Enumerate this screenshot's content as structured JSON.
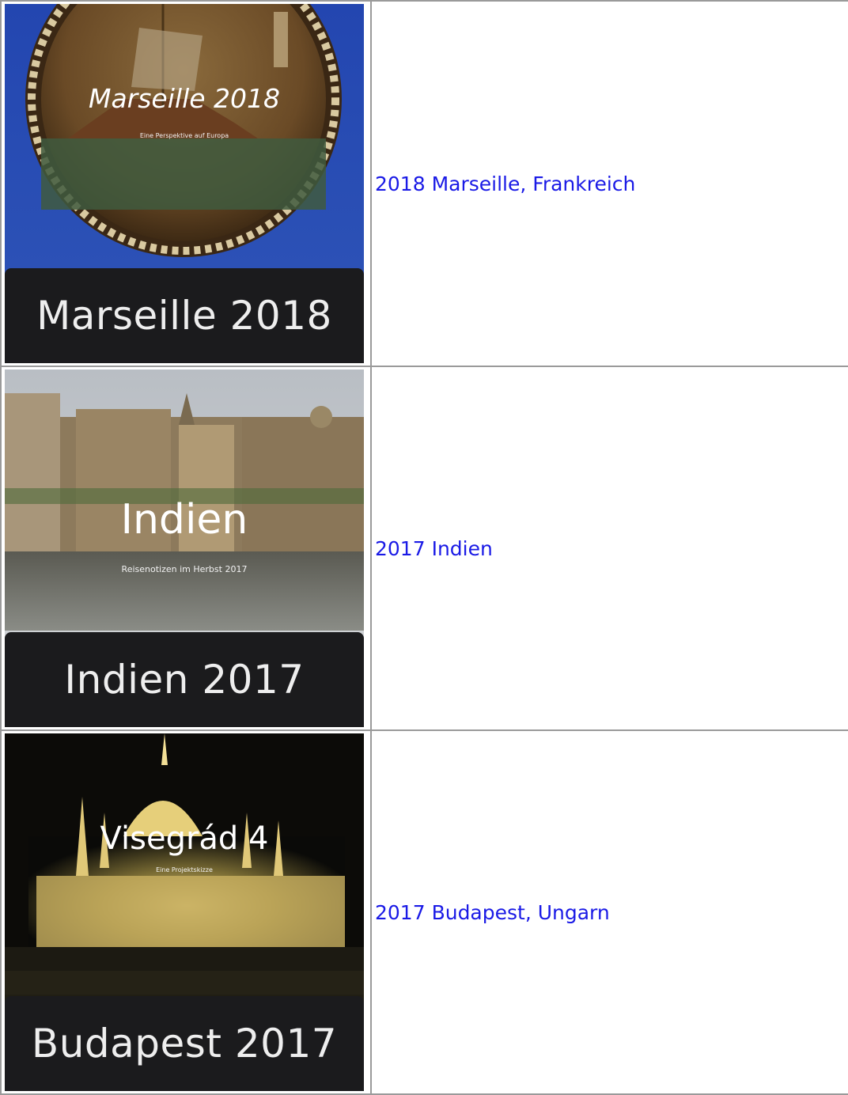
{
  "rows": [
    {
      "cover_title": "Marseille 2018",
      "cover_subtitle": "Eine Perspektive auf Europa",
      "caption": "Marseille 2018",
      "link": "2018 Marseille, Frankreich"
    },
    {
      "cover_title": "Indien",
      "cover_subtitle": "Reisenotizen im Herbst 2017",
      "caption": "Indien 2017",
      "link": "2017 Indien"
    },
    {
      "cover_title": "Visegrád 4",
      "cover_subtitle": "Eine Projektskizze",
      "caption": "Budapest 2017",
      "link": "2017 Budapest, Ungarn"
    }
  ],
  "colors": {
    "link": "#1a1ae6",
    "border": "#9a9a9a",
    "caption_bar": "#1b1b1d"
  }
}
